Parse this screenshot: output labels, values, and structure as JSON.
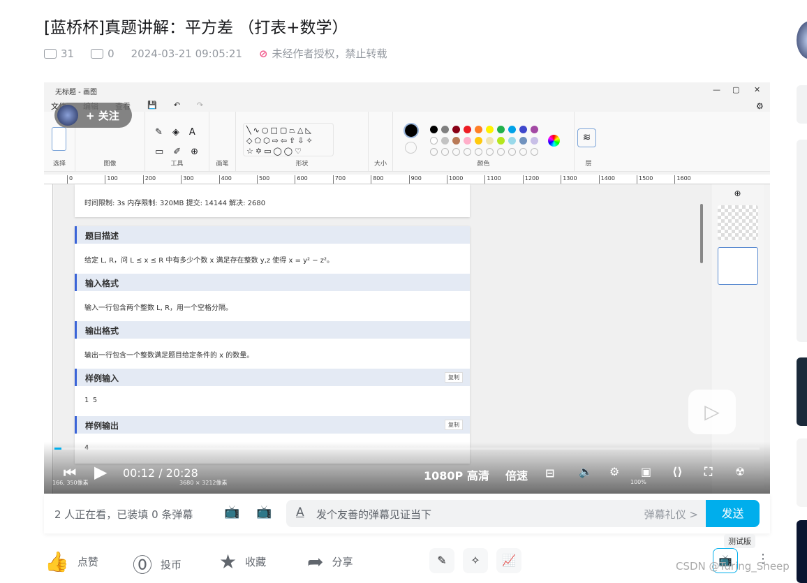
{
  "header": {
    "title": "[蓝桥杯]真题讲解：平方差 （打表+数学）",
    "views": "31",
    "danmaku_count": "0",
    "datetime": "2024-03-21 09:05:21",
    "copyright_notice": "未经作者授权，禁止转载"
  },
  "paint": {
    "window_title": "无标题 - 画图",
    "menu": [
      "文件",
      "编辑",
      "查看"
    ],
    "follow_label": "+ 关注",
    "groups": {
      "select": "选择",
      "image": "图像",
      "tools": "工具",
      "brush": "画笔",
      "shapes": "形状",
      "size": "大小",
      "colors": "颜色",
      "layers": "层"
    },
    "palette_row1": [
      "#000000",
      "#7f7f7f",
      "#880015",
      "#ed1c24",
      "#ff7f27",
      "#fff200",
      "#22b14c",
      "#00a2e8",
      "#3f48cc",
      "#a349a4"
    ],
    "palette_row2": [
      "#ffffff",
      "#c3c3c3",
      "#b97a57",
      "#ffaec9",
      "#ffc90e",
      "#efe4b0",
      "#b5e61d",
      "#99d9ea",
      "#7092be",
      "#c8bfe7"
    ],
    "ruler": [
      "0",
      "100",
      "200",
      "300",
      "400",
      "500",
      "600",
      "700",
      "800",
      "900",
      "1000",
      "1100",
      "1200",
      "1300",
      "1400",
      "1500",
      "1600"
    ],
    "problem": {
      "limits": "时间限制: 3s 内存限制: 320MB 提交: 14144 解决: 2680",
      "sections": [
        {
          "title": "题目描述",
          "body": "给定 L, R，问 L ≤ x ≤ R 中有多少个数 x 满足存在整数 y,z 使得 x = y² − z²。",
          "copy": ""
        },
        {
          "title": "输入格式",
          "body": "输入一行包含两个整数 L, R，用一个空格分隔。",
          "copy": ""
        },
        {
          "title": "输出格式",
          "body": "输出一行包含一个整数满足题目给定条件的 x 的数量。",
          "copy": ""
        },
        {
          "title": "样例输入",
          "body": "1 5",
          "copy": "复制"
        },
        {
          "title": "样例输出",
          "body": "4",
          "copy": "复制"
        }
      ]
    },
    "status": {
      "cursor": "166, 350像素",
      "canvas_size": "3680 × 3212像素",
      "zoom": "100%"
    }
  },
  "player": {
    "current_time": "00:12",
    "duration": "20:28",
    "progress_fraction": 0.01,
    "quality": "1080P 高清",
    "speed": "倍速"
  },
  "danmaku": {
    "status": "2 人正在看，已装填 0 条弹幕",
    "placeholder": "发个友善的弹幕见证当下",
    "etiquette": "弹幕礼仪 >",
    "send": "发送"
  },
  "actions": {
    "like": "点赞",
    "coin": "投币",
    "favorite": "收藏",
    "share": "分享",
    "beta": "测试版"
  },
  "watermark": "CSDN @Turing_Sheep",
  "colors": {
    "accent": "#00aeec",
    "warn": "#f25d8e"
  }
}
